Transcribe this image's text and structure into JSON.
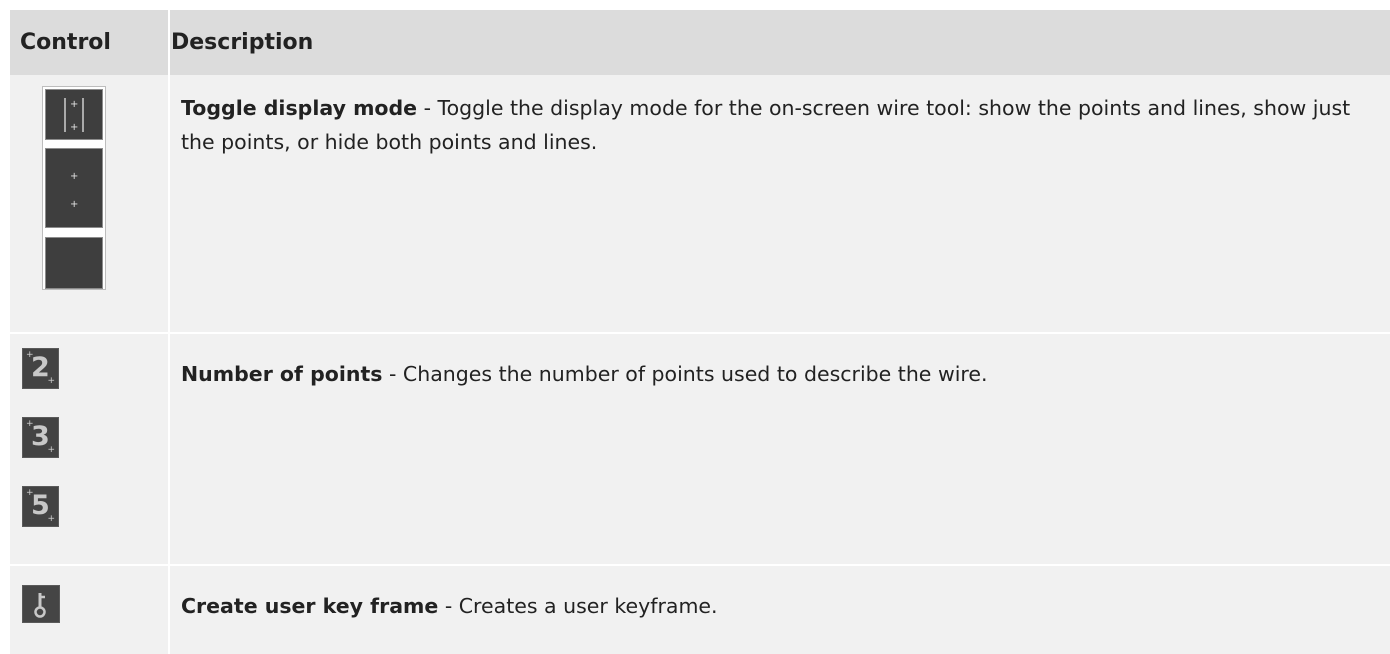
{
  "table": {
    "headers": {
      "control": "Control",
      "description": "Description"
    },
    "rows": [
      {
        "title": "Toggle display mode",
        "separator": " - ",
        "text": "Toggle the display mode for the on-screen wire tool: show the points and lines, show just the points, or hide both points and lines.",
        "icons": [
          "display-points-lines-icon",
          "display-points-icon",
          "display-hidden-icon"
        ]
      },
      {
        "title": "Number of points",
        "separator": " - ",
        "text": "Changes the number of points used to describe the wire.",
        "icons": [
          "two-points-icon",
          "three-points-icon",
          "five-points-icon"
        ],
        "icon_digits": [
          "2",
          "3",
          "5"
        ]
      },
      {
        "title": "Create user key frame",
        "separator": " - ",
        "text": "Creates a user keyframe.",
        "icons": [
          "key-icon"
        ]
      }
    ]
  },
  "colors": {
    "header_bg": "#dcdcdc",
    "row_bg": "#f1f1f1",
    "icon_bg": "#3e3e3e",
    "text": "#222222"
  }
}
